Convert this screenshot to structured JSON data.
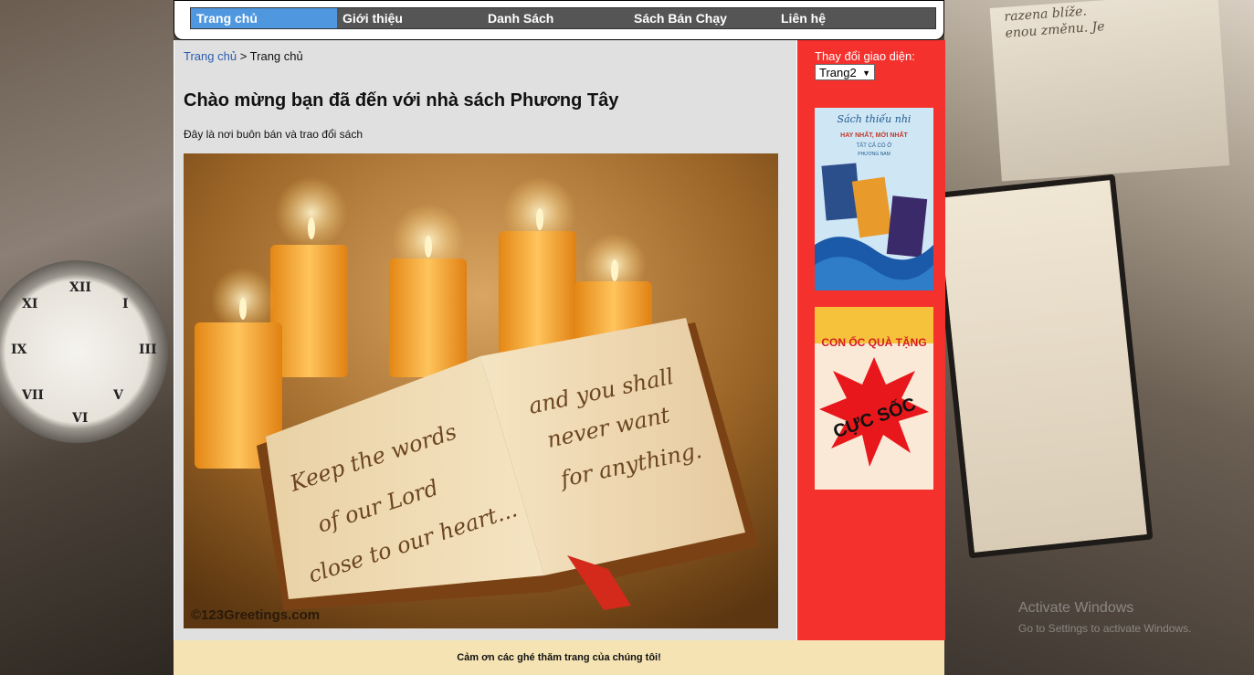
{
  "nav": {
    "items": [
      {
        "label": "Trang chủ",
        "active": true
      },
      {
        "label": "Giới thiệu",
        "active": false
      },
      {
        "label": "Danh Sách",
        "active": false
      },
      {
        "label": "Sách Bán Chạy",
        "active": false
      },
      {
        "label": "Liên hệ",
        "active": false
      }
    ]
  },
  "breadcrumb": {
    "link": "Trang chủ",
    "separator": ">",
    "current": "Trang chủ"
  },
  "main": {
    "title": "Chào mừng bạn đã đến với nhà sách Phương Tây",
    "description": "Đây là nơi buôn bán và trao đổi sách",
    "hero": {
      "left_page_text": [
        "Keep the words",
        "of our Lord",
        "close to our heart..."
      ],
      "right_page_text": [
        "and you shall",
        "never want",
        "for anything."
      ],
      "credit": "©123Greetings.com"
    }
  },
  "sidebar": {
    "theme_label": "Thay đổi giao diện:",
    "theme_value": "Trang2",
    "banner1": {
      "heading": "Sách thiếu nhi",
      "sub": "HAY NHẤT, MỚI NHẤT",
      "sub2": "TẤT CẢ CÓ Ở",
      "sub3": "PHƯƠNG NAM"
    },
    "banner2": {
      "top": "CON ỐC QUÀ TẶNG",
      "main": "CỰC SỐC"
    }
  },
  "footer": {
    "text": "Cảm ơn các ghé thăm trang của chúng tôi!"
  },
  "background": {
    "script_lines": [
      "razena blíže.",
      "enou změnu. Je"
    ],
    "watermark": [
      "Activate Windows",
      "Go to Settings to activate Windows."
    ]
  },
  "colors": {
    "nav_active": "#4f98e0",
    "nav_bg": "#555555",
    "sidebar": "#f5312d",
    "footer": "#f5e3b3",
    "content": "#e0e0e0"
  }
}
